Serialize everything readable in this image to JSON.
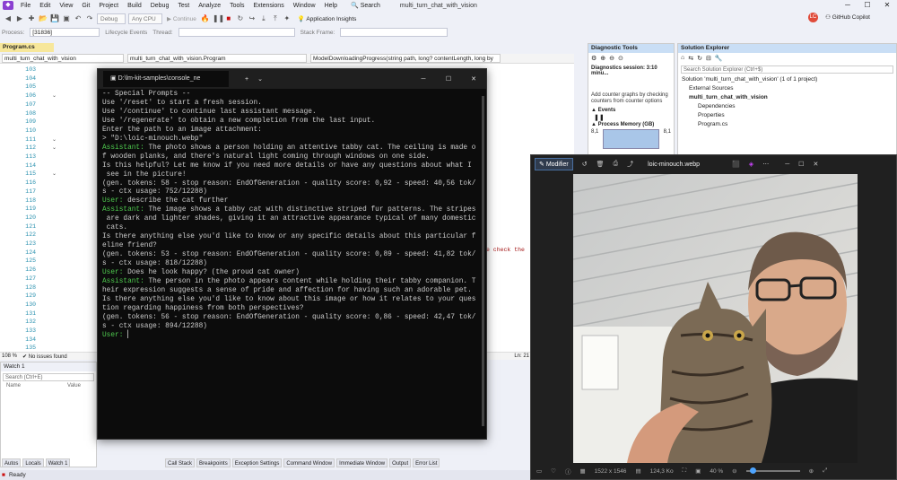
{
  "vs": {
    "logo": "◆",
    "menu": [
      "File",
      "Edit",
      "View",
      "Git",
      "Project",
      "Build",
      "Debug",
      "Test",
      "Analyze",
      "Tools",
      "Extensions",
      "Window",
      "Help"
    ],
    "search_label": "Search",
    "solution_title": "multi_turn_chat_with_vision",
    "avatar_initials": "LC",
    "copilot_label": "GitHub Copilot",
    "toolbar": {
      "config": "Debug",
      "platform": "Any CPU",
      "continue_label": "Continue",
      "app_insights": "Application Insights"
    },
    "debugbar": {
      "process_label": "Process:",
      "process_value": "[31836] multi_turn_chat_with_visic",
      "lifecycle_label": "Lifecycle Events",
      "thread_label": "Thread:",
      "stackframe_label": "Stack Frame:"
    },
    "editor": {
      "tab_label": "Program.cs",
      "nav": [
        "multi_turn_chat_with_vision",
        "multi_turn_chat_with_vision.Program",
        "ModelDownloadingProgress(string path, long? contentLength, long by"
      ],
      "line_numbers": [
        "103",
        "104",
        "105",
        "106",
        "107",
        "108",
        "109",
        "110",
        "111",
        "112",
        "113",
        "114",
        "115",
        "116",
        "117",
        "118",
        "119",
        "120",
        "121",
        "122",
        "123",
        "124",
        "125",
        "126",
        "127",
        "128",
        "129",
        "130",
        "131",
        "132",
        "133",
        "134",
        "135"
      ],
      "hint_text": "e check the",
      "zoom": "108 %",
      "issues": "No issues found",
      "line_info": "Ln: 21"
    },
    "watch": {
      "title": "Watch 1",
      "search_placeholder": "Search (Ctrl+E)",
      "col_name": "Name",
      "col_value": "Value"
    },
    "bottom_tabs_left": [
      "Autos",
      "Locals",
      "Watch 1"
    ],
    "bottom_tabs_right": [
      "Call Stack",
      "Breakpoints",
      "Exception Settings",
      "Command Window",
      "Immediate Window",
      "Output",
      "Error List"
    ],
    "status": "Ready",
    "diagnostics": {
      "title": "Diagnostic Tools",
      "session": "Diagnostics session: 3:10 minu...",
      "add_counter": "Add counter graphs by checking counters from counter options",
      "events": "Events",
      "process_memory": "Process Memory (GB)",
      "mem_left": "8,1",
      "mem_right": "8,1"
    },
    "solution": {
      "title": "Solution Explorer",
      "search_placeholder": "Search Solution Explorer (Ctrl+$)",
      "items": [
        "Solution 'multi_turn_chat_with_vision' (1 of 1 project)",
        "External Sources",
        "multi_turn_chat_with_vision",
        "Dependencies",
        "Properties",
        "Program.cs"
      ]
    }
  },
  "console": {
    "tab_title": "D:\\lm-kit-samples\\console_ne",
    "lines": [
      {
        "t": "",
        "c": ""
      },
      {
        "t": "-- Special Prompts --",
        "c": ""
      },
      {
        "t": "Use '/reset' to start a fresh session.",
        "c": ""
      },
      {
        "t": "Use '/continue' to continue last assistant message.",
        "c": ""
      },
      {
        "t": "Use '/regenerate' to obtain a new completion from the last input.",
        "c": ""
      },
      {
        "t": "",
        "c": ""
      },
      {
        "t": "",
        "c": ""
      },
      {
        "t": "Enter the path to an image attachment:",
        "c": ""
      },
      {
        "t": "",
        "c": ""
      },
      {
        "t": "> \"D:\\loic-minouch.webp\"",
        "c": ""
      },
      {
        "t": "",
        "c": ""
      },
      {
        "p": "Assistant:",
        "t": " The photo shows a person holding an attentive tabby cat. The ceiling is made o",
        "c": "assist"
      },
      {
        "t": "f wooden planks, and there's natural light coming through windows on one side.",
        "c": ""
      },
      {
        "t": "",
        "c": ""
      },
      {
        "t": "Is this helpful? Let me know if you need more details or have any questions about what I",
        "c": ""
      },
      {
        "t": " see in the picture!",
        "c": ""
      },
      {
        "t": "(gen. tokens: 58 - stop reason: EndOfGeneration - quality score: 0,92 - speed: 40,56 tok/",
        "c": ""
      },
      {
        "t": "s - ctx usage: 752/12288)",
        "c": ""
      },
      {
        "t": "",
        "c": ""
      },
      {
        "p": "User:",
        "t": " describe the cat further",
        "c": "user"
      },
      {
        "p": "Assistant:",
        "t": " The image shows a tabby cat with distinctive striped fur patterns. The stripes",
        "c": "assist"
      },
      {
        "t": " are dark and lighter shades, giving it an attractive appearance typical of many domestic",
        "c": ""
      },
      {
        "t": " cats.",
        "c": ""
      },
      {
        "t": "",
        "c": ""
      },
      {
        "t": "Is there anything else you'd like to know or any specific details about this particular f",
        "c": ""
      },
      {
        "t": "eline friend?",
        "c": ""
      },
      {
        "t": "(gen. tokens: 53 - stop reason: EndOfGeneration - quality score: 0,89 - speed: 41,82 tok/",
        "c": ""
      },
      {
        "t": "s - ctx usage: 818/12288)",
        "c": ""
      },
      {
        "t": "",
        "c": ""
      },
      {
        "p": "User:",
        "t": " Does he look happy? (the proud cat owner)",
        "c": "user"
      },
      {
        "p": "Assistant:",
        "t": " The person in the photo appears content while holding their tabby companion. T",
        "c": "assist"
      },
      {
        "t": "heir expression suggests a sense of pride and affection for having such an adorable pet.",
        "c": ""
      },
      {
        "t": "",
        "c": ""
      },
      {
        "t": "Is there anything else you'd like to know about this image or how it relates to your ques",
        "c": ""
      },
      {
        "t": "tion regarding happiness from both perspectives?",
        "c": ""
      },
      {
        "t": "(gen. tokens: 56 - stop reason: EndOfGeneration - quality score: 0,86 - speed: 42,47 tok/",
        "c": ""
      },
      {
        "t": "s - ctx usage: 894/12288)",
        "c": ""
      },
      {
        "t": "",
        "c": ""
      },
      {
        "p": "User:",
        "t": " ",
        "c": "user"
      }
    ]
  },
  "photos": {
    "modify_label": "Modifier",
    "filename": "loic-minouch.webp",
    "dimensions": "1522 x 1546",
    "filesize": "124,3 Ko",
    "zoom": "40 %"
  }
}
